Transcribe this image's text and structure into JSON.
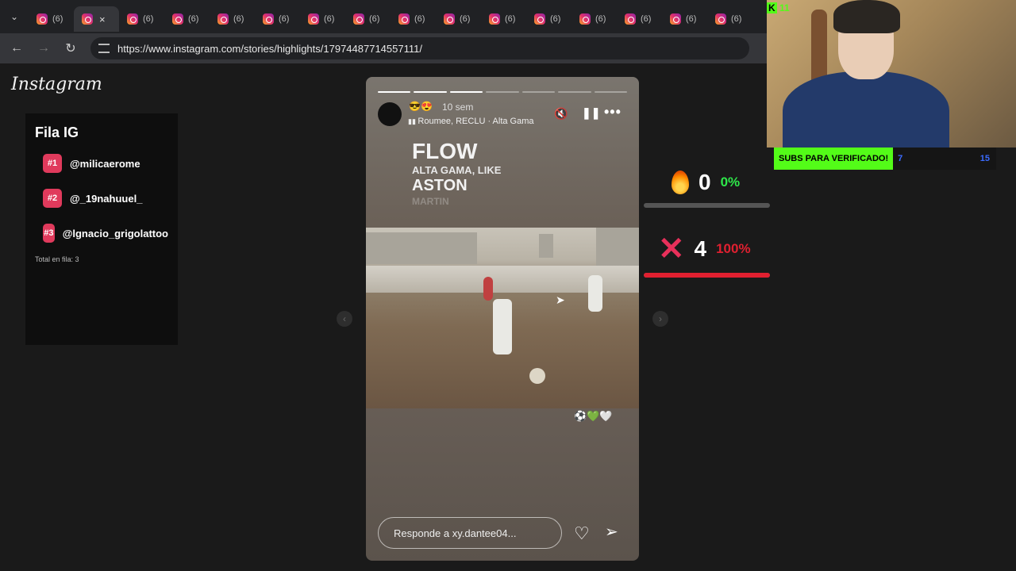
{
  "browser": {
    "tab_count_label": "(6)",
    "tab_total": 16,
    "active_tab_index": 1,
    "close_glyph": "×",
    "url": "https://www.instagram.com/stories/highlights/17974487714557111/"
  },
  "page": {
    "logo_text": "Instagram"
  },
  "queue": {
    "title": "Fila IG",
    "items": [
      {
        "rank": "#1",
        "handle": "@milicaerome"
      },
      {
        "rank": "#2",
        "handle": "@_19nahuuel_"
      },
      {
        "rank": "#3",
        "handle": "@lgnacio_grigolattoo"
      }
    ],
    "total": "Total en fila: 3"
  },
  "story": {
    "progress_total": 7,
    "progress_done": 3,
    "emojis": "😎😍",
    "time": "10 sem",
    "music": "Roumee, RECLU · Alta Gama",
    "text_flow": "FLOW",
    "text_alta": "ALTA GAMA, LIKE",
    "text_aston": "ASTON",
    "text_martin": "MARTIN",
    "caption_emojis": "⚽💚🤍",
    "reply_placeholder": "Responde a xy.dantee04..."
  },
  "vote": {
    "fire": {
      "count": "0",
      "percent": "0%",
      "fill": 0,
      "color": "#2ee84a"
    },
    "cross": {
      "count": "4",
      "percent": "100%",
      "fill": 1,
      "color": "#e02030"
    }
  },
  "stream": {
    "kick_badge": "11",
    "sub_label": "SUBS PARA VERIFICADO!",
    "sub_current": "7",
    "sub_goal": "15"
  },
  "colors": {
    "accent_pink": "#e03a5c",
    "kick_green": "#53fc18"
  }
}
